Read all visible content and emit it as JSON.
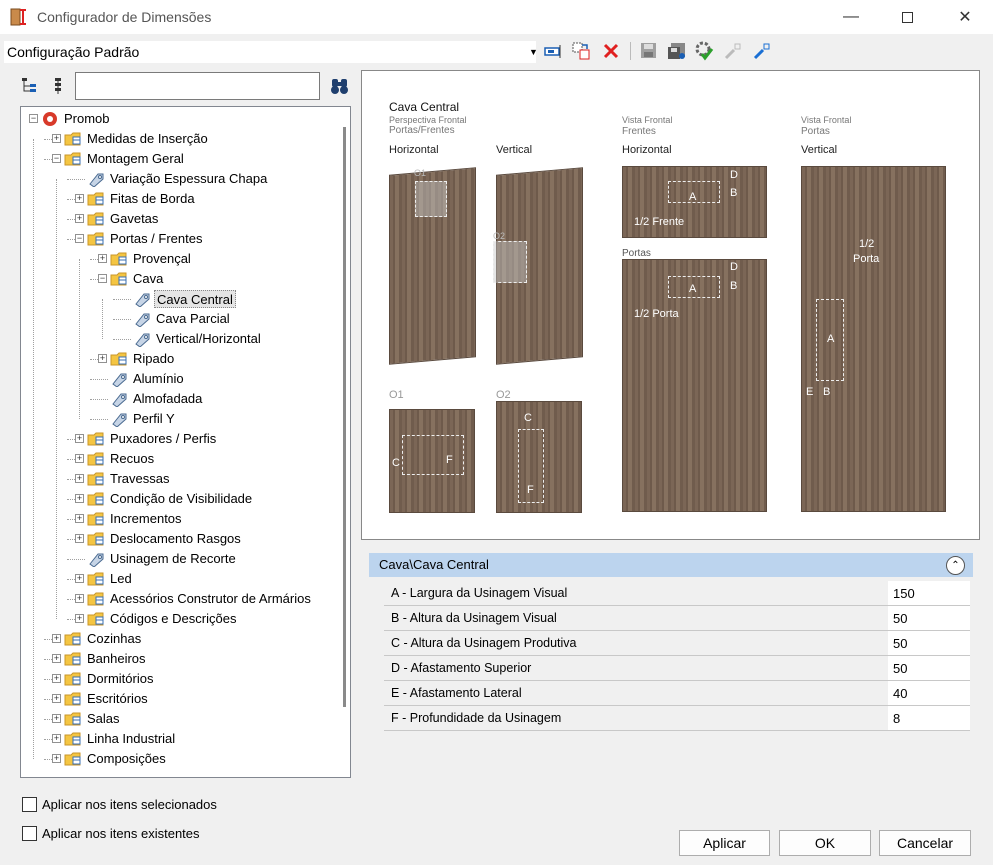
{
  "window": {
    "title": "Configurador de Dimensões"
  },
  "config": {
    "selected": "Configuração Padrão"
  },
  "tree": [
    {
      "label": "Promob",
      "depth": 0,
      "exp": "-",
      "icon": "promob"
    },
    {
      "label": "Medidas de Inserção",
      "depth": 1,
      "exp": "+",
      "icon": "folder"
    },
    {
      "label": "Montagem Geral",
      "depth": 1,
      "exp": "-",
      "icon": "folder"
    },
    {
      "label": "Variação Espessura Chapa",
      "depth": 2,
      "exp": "",
      "icon": "tag"
    },
    {
      "label": "Fitas de Borda",
      "depth": 2,
      "exp": "+",
      "icon": "folder"
    },
    {
      "label": "Gavetas",
      "depth": 2,
      "exp": "+",
      "icon": "folder"
    },
    {
      "label": "Portas / Frentes",
      "depth": 2,
      "exp": "-",
      "icon": "folder"
    },
    {
      "label": "Provençal",
      "depth": 3,
      "exp": "+",
      "icon": "folder"
    },
    {
      "label": "Cava",
      "depth": 3,
      "exp": "-",
      "icon": "folder"
    },
    {
      "label": "Cava Central",
      "depth": 4,
      "exp": "",
      "icon": "tag",
      "selected": true
    },
    {
      "label": "Cava Parcial",
      "depth": 4,
      "exp": "",
      "icon": "tag"
    },
    {
      "label": "Vertical/Horizontal",
      "depth": 4,
      "exp": "",
      "icon": "tag"
    },
    {
      "label": "Ripado",
      "depth": 3,
      "exp": "+",
      "icon": "folder"
    },
    {
      "label": "Alumínio",
      "depth": 3,
      "exp": "",
      "icon": "tag"
    },
    {
      "label": "Almofadada",
      "depth": 3,
      "exp": "",
      "icon": "tag"
    },
    {
      "label": "Perfil Y",
      "depth": 3,
      "exp": "",
      "icon": "tag"
    },
    {
      "label": "Puxadores / Perfis",
      "depth": 2,
      "exp": "+",
      "icon": "folder"
    },
    {
      "label": "Recuos",
      "depth": 2,
      "exp": "+",
      "icon": "folder"
    },
    {
      "label": "Travessas",
      "depth": 2,
      "exp": "+",
      "icon": "folder"
    },
    {
      "label": "Condição de Visibilidade",
      "depth": 2,
      "exp": "+",
      "icon": "folder"
    },
    {
      "label": "Incrementos",
      "depth": 2,
      "exp": "+",
      "icon": "folder"
    },
    {
      "label": "Deslocamento Rasgos",
      "depth": 2,
      "exp": "+",
      "icon": "folder"
    },
    {
      "label": "Usinagem de Recorte",
      "depth": 2,
      "exp": "",
      "icon": "tag"
    },
    {
      "label": "Led",
      "depth": 2,
      "exp": "+",
      "icon": "folder"
    },
    {
      "label": "Acessórios Construtor de Armários",
      "depth": 2,
      "exp": "+",
      "icon": "folder"
    },
    {
      "label": "Códigos e Descrições",
      "depth": 2,
      "exp": "+",
      "icon": "folder"
    },
    {
      "label": "Cozinhas",
      "depth": 1,
      "exp": "+",
      "icon": "folder"
    },
    {
      "label": "Banheiros",
      "depth": 1,
      "exp": "+",
      "icon": "folder"
    },
    {
      "label": "Dormitórios",
      "depth": 1,
      "exp": "+",
      "icon": "folder"
    },
    {
      "label": "Escritórios",
      "depth": 1,
      "exp": "+",
      "icon": "folder"
    },
    {
      "label": "Salas",
      "depth": 1,
      "exp": "+",
      "icon": "folder"
    },
    {
      "label": "Linha Industrial",
      "depth": 1,
      "exp": "+",
      "icon": "folder"
    },
    {
      "label": "Composições",
      "depth": 1,
      "exp": "+",
      "icon": "folder"
    }
  ],
  "checkboxes": {
    "selected_items": "Aplicar nos itens selecionados",
    "existing_items": "Aplicar nos itens existentes"
  },
  "preview": {
    "title": "Cava Central",
    "sub1": "Perspectiva Frontal",
    "sub2": "Portas/Frentes",
    "horizontal": "Horizontal",
    "vertical": "Vertical",
    "vf1": "Vista Frontal",
    "vf_frentes": "Frentes",
    "vf2": "Vista Frontal",
    "vf_portas": "Portas",
    "portas": "Portas",
    "o1": "O1",
    "o2": "O2",
    "half_frente": "1/2 Frente",
    "half_porta": "1/2 Porta",
    "half_porta_v1": "1/2",
    "half_porta_v2": "Porta",
    "a": "A",
    "b": "B",
    "c": "C",
    "d": "D",
    "e": "E",
    "f": "F"
  },
  "properties": {
    "section": "Cava\\Cava Central",
    "rows": [
      {
        "name": "A - Largura da Usinagem Visual",
        "value": "150"
      },
      {
        "name": "B - Altura da Usinagem Visual",
        "value": "50"
      },
      {
        "name": "C - Altura da Usinagem Produtiva",
        "value": "50"
      },
      {
        "name": "D - Afastamento Superior",
        "value": "50"
      },
      {
        "name": "E - Afastamento Lateral",
        "value": "40"
      },
      {
        "name": "F - Profundidade da Usinagem",
        "value": "8"
      }
    ]
  },
  "buttons": {
    "apply": "Aplicar",
    "ok": "OK",
    "cancel": "Cancelar"
  },
  "colors": {
    "header_bg": "#bcd4ee",
    "delete_red": "#e02020",
    "promob_red": "#d83a2a",
    "folder_yellow": "#f4c542"
  }
}
